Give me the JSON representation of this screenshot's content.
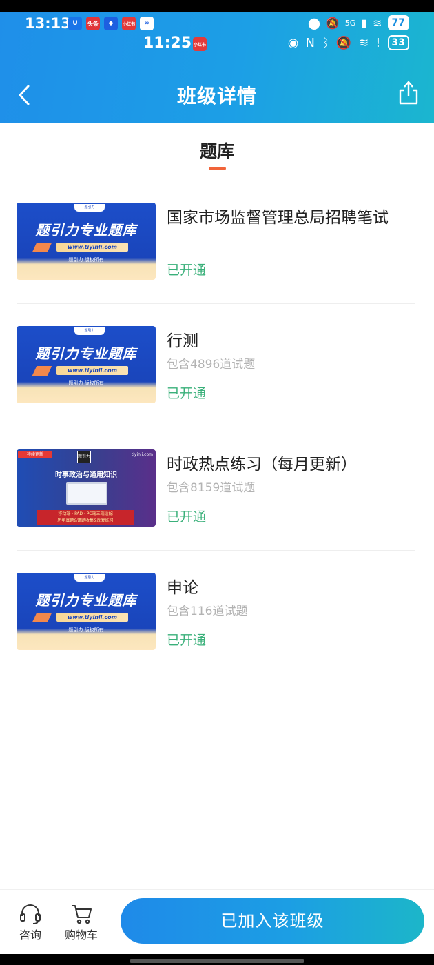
{
  "status_bar": {
    "time_outer": "13:13",
    "time_inner": "11:25",
    "battery_outer": "77",
    "battery_inner": "33",
    "network": "5G",
    "apps_outer": [
      {
        "icon": "security-app-icon",
        "label": "U",
        "color": "#1a74e8"
      },
      {
        "icon": "toutiao-app-icon",
        "label": "头条",
        "color": "#e0353a"
      },
      {
        "icon": "app-icon",
        "label": "◆",
        "color": "#1d5fe0"
      },
      {
        "icon": "xiaohongshu-app-icon",
        "label": "小红书",
        "color": "#e33a3a"
      },
      {
        "icon": "baidu-netdisk-app-icon",
        "label": "∞",
        "color": "#ffffff"
      }
    ],
    "app_inner": {
      "icon": "xiaohongshu-app-icon",
      "label": "小红书",
      "color": "#e33a3a"
    }
  },
  "header": {
    "title": "班级详情",
    "back_icon": "back-arrow-icon",
    "share_icon": "share-icon"
  },
  "tab": {
    "label": "题库"
  },
  "items": [
    {
      "thumb": "banner",
      "banner_tag": "题引力",
      "banner_title": "题引力专业题库",
      "banner_url": "www.tiyinli.com",
      "banner_copy": "题引力 版权所有",
      "name": "国家市场监督管理总局招聘笔试",
      "count": "",
      "status": "已开通"
    },
    {
      "thumb": "banner",
      "banner_tag": "题引力",
      "banner_title": "题引力专业题库",
      "banner_url": "www.tiyinli.com",
      "banner_copy": "题引力 版权所有",
      "name": "行测",
      "count": "包含4896道试题",
      "status": "已开通"
    },
    {
      "thumb": "promo",
      "promo_badge": "持续更新",
      "promo_logo": "题引力",
      "promo_site": "tiyinli.com",
      "promo_subtitle": "时事政治与通用知识",
      "promo_red_line1": "移动端 · PAD · PC端三端适配",
      "promo_red_line2": "历年真题&错题收集&反复练习",
      "name": "时政热点练习（每月更新）",
      "count": "包含8159道试题",
      "status": "已开通"
    },
    {
      "thumb": "banner",
      "banner_tag": "题引力",
      "banner_title": "题引力专业题库",
      "banner_url": "www.tiyinli.com",
      "banner_copy": "题引力 版权所有",
      "name": "申论",
      "count": "包含116道试题",
      "status": "已开通"
    }
  ],
  "bottom_bar": {
    "consult_label": "咨询",
    "consult_icon": "headset-icon",
    "cart_label": "购物车",
    "cart_icon": "cart-icon",
    "join_label": "已加入该班级"
  },
  "colors": {
    "accent": "#1f8fe9",
    "status_green": "#3ab07a",
    "tab_underline": "#f1643a"
  }
}
